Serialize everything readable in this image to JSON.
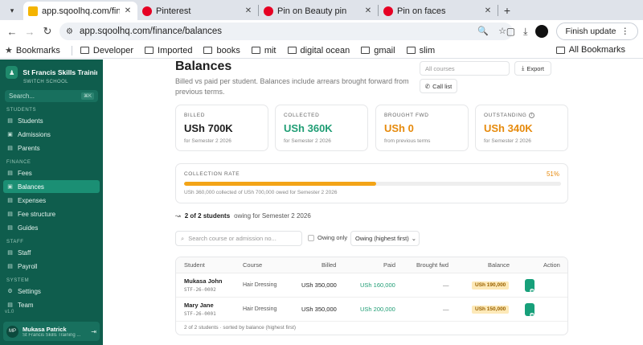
{
  "browser": {
    "tabs": [
      {
        "title": "app.sqoolhq.com/finance/b",
        "active": true
      },
      {
        "title": "Pinterest"
      },
      {
        "title": "Pin on Beauty pin"
      },
      {
        "title": "Pin on faces"
      }
    ],
    "url": "app.sqoolhq.com/finance/balances",
    "finish_update": "Finish update",
    "bookmarks": [
      "Bookmarks",
      "Developer",
      "Imported",
      "books",
      "mit",
      "digital ocean",
      "gmail",
      "slim"
    ],
    "all_bookmarks": "All Bookmarks"
  },
  "sidebar": {
    "school": "St Francis Skills Training ...",
    "switch": "SWITCH SCHOOL",
    "search_placeholder": "Search...",
    "search_kbd": "⌘K",
    "sections": [
      {
        "title": "STUDENTS",
        "items": [
          "Students",
          "Admissions",
          "Parents"
        ]
      },
      {
        "title": "FINANCE",
        "items": [
          "Fees",
          "Balances",
          "Expenses",
          "Fee structure",
          "Guides"
        ]
      },
      {
        "title": "STAFF",
        "items": [
          "Staff",
          "Payroll"
        ]
      },
      {
        "title": "SYSTEM",
        "items": [
          "Settings",
          "Team"
        ]
      }
    ],
    "active_item": "Balances",
    "version": "v1.0",
    "user": {
      "initials": "MP",
      "name": "Mukasa Patrick",
      "school": "St Francis Skills Training ..."
    }
  },
  "page": {
    "title": "Balances",
    "description": "Billed vs paid per student. Balances include arrears brought forward from previous terms.",
    "courses_select": "All courses",
    "export_label": "Export",
    "call_list_label": "Call list",
    "cards": [
      {
        "label": "BILLED",
        "value": "USh 700K",
        "sub": "for Semester 2 2026",
        "tone": "default"
      },
      {
        "label": "COLLECTED",
        "value": "USh 360K",
        "sub": "for Semester 2 2026",
        "tone": "green"
      },
      {
        "label": "BROUGHT FWD",
        "value": "USh 0",
        "sub": "from previous terms",
        "tone": "orange"
      },
      {
        "label": "OUTSTANDING",
        "value": "USh 340K",
        "sub": "for Semester 2 2026",
        "tone": "orange"
      }
    ],
    "collection_rate": {
      "label": "COLLECTION RATE",
      "percent_text": "51%",
      "fraction": 0.51,
      "note": "USh 360,000 collected of USh 700,000 owed for Semester 2 2026"
    },
    "owing_summary": {
      "count": "2 of 2 students",
      "rest": "owing for Semester 2 2026"
    },
    "search_placeholder": "Search course or admission no...",
    "owing_only_label": "Owing only",
    "sort_label": "Owing (highest first)",
    "table": {
      "headers": [
        "Student",
        "Course",
        "Billed",
        "Paid",
        "Brought fwd",
        "Balance",
        "Action"
      ],
      "rows": [
        {
          "name": "Mukasa John",
          "adm": "STF-26-0002",
          "course": "Hair Dressing",
          "billed": "USh 350,000",
          "paid": "USh 160,000",
          "brought_fwd": "—",
          "balance": "USh 190,000",
          "action": "Collect"
        },
        {
          "name": "Mary Jane",
          "adm": "STF-26-0001",
          "course": "Hair Dressing",
          "billed": "USh 350,000",
          "paid": "USh 200,000",
          "brought_fwd": "—",
          "balance": "USh 150,000",
          "action": "Collect"
        }
      ],
      "footer": "2 of 2 students · sorted by balance (highest first)"
    }
  },
  "colors": {
    "sidebar": "#0f5d4d",
    "accent": "#17a07a",
    "orange": "#e68a0c",
    "green": "#1f9d74"
  }
}
